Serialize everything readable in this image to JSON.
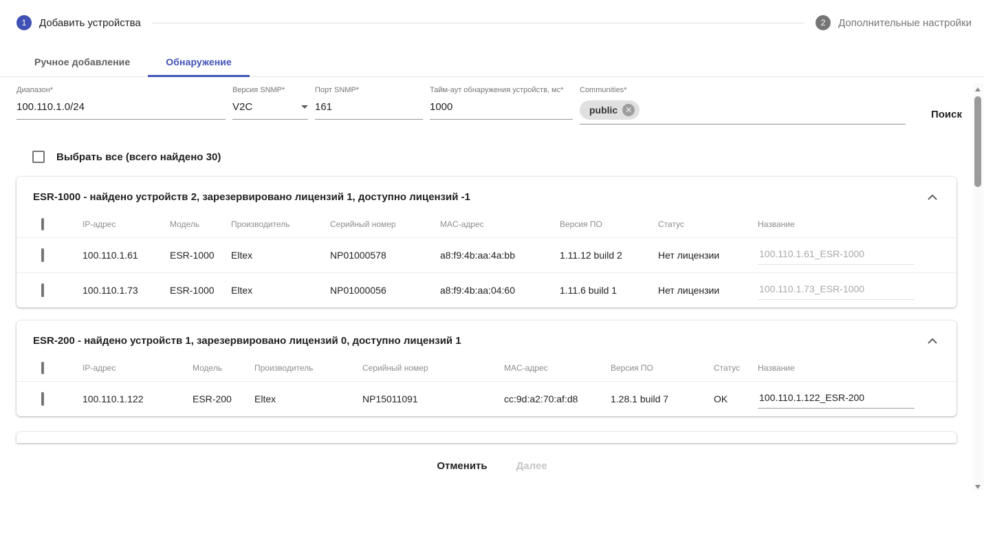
{
  "colors": {
    "accent": "#3f51b5",
    "step_inactive": "#757575"
  },
  "stepper": {
    "steps": [
      {
        "number": "1",
        "label": "Добавить устройства"
      },
      {
        "number": "2",
        "label": "Дополнительные настройки"
      }
    ]
  },
  "tabs": [
    {
      "label": "Ручное добавление"
    },
    {
      "label": "Обнаружение"
    }
  ],
  "filters": {
    "range": {
      "label": "Диапазон*",
      "value": "100.110.1.0/24"
    },
    "snmp_version": {
      "label": "Версия SNMP*",
      "value": "V2C"
    },
    "snmp_port": {
      "label": "Порт SNMP*",
      "value": "161"
    },
    "timeout": {
      "label": "Тайм-аут обнаружения устройств, мс*",
      "value": "1000"
    },
    "communities": {
      "label": "Communities*",
      "chips": [
        "public"
      ]
    },
    "search_label": "Поиск"
  },
  "select_all": {
    "label": "Выбрать все (всего найдено 30)",
    "checked": false
  },
  "groups": [
    {
      "title": "ESR-1000 - найдено устройств 2, зарезервировано лицензий 1, доступно лицензий -1",
      "columns": [
        "IP-адрес",
        "Модель",
        "Производитель",
        "Серийный номер",
        "MAC-адрес",
        "Версия ПО",
        "Статус",
        "Название"
      ],
      "rows": [
        {
          "ip": "100.110.1.61",
          "model": "ESR-1000",
          "vendor": "Eltex",
          "serial": "NP01000578",
          "mac": "a8:f9:4b:aa:4a:bb",
          "firmware": "1.11.12 build 2",
          "status": "Нет лицензии",
          "name": "100.110.1.61_ESR-1000",
          "name_disabled": true
        },
        {
          "ip": "100.110.1.73",
          "model": "ESR-1000",
          "vendor": "Eltex",
          "serial": "NP01000056",
          "mac": "a8:f9:4b:aa:04:60",
          "firmware": "1.11.6 build 1",
          "status": "Нет лицензии",
          "name": "100.110.1.73_ESR-1000",
          "name_disabled": true
        }
      ]
    },
    {
      "title": "ESR-200 - найдено устройств 1, зарезервировано лицензий 0, доступно лицензий 1",
      "columns": [
        "IP-адрес",
        "Модель",
        "Производитель",
        "Серийный номер",
        "MAC-адрес",
        "Версия ПО",
        "Статус",
        "Название"
      ],
      "rows": [
        {
          "ip": "100.110.1.122",
          "model": "ESR-200",
          "vendor": "Eltex",
          "serial": "NP15011091",
          "mac": "cc:9d:a2:70:af:d8",
          "firmware": "1.28.1 build 7",
          "status": "OK",
          "name": "100.110.1.122_ESR-200",
          "name_disabled": false
        }
      ]
    }
  ],
  "footer": {
    "cancel_label": "Отменить",
    "next_label": "Далее"
  }
}
